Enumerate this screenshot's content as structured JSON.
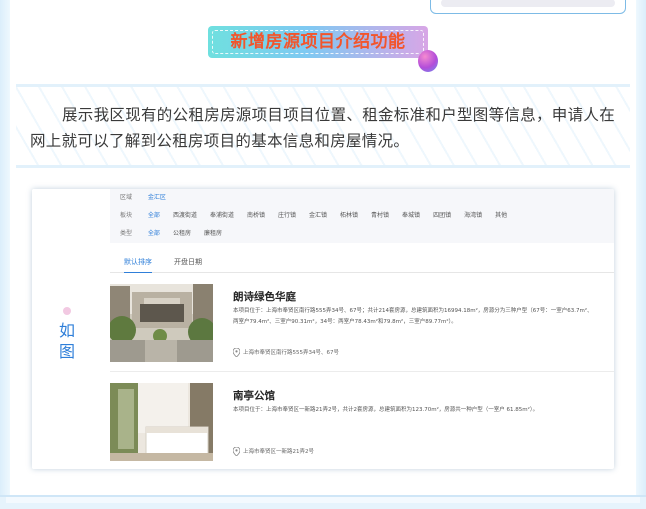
{
  "banner": {
    "title": "新增房源项目介绍功能"
  },
  "description": "展示我区现有的公租房房源项目项目位置、租金标准和户型图等信息，申请人在网上就可以了解到公租房项目的基本信息和房屋情况。",
  "example": {
    "side_label": "如\n图",
    "filters": [
      {
        "label": "区域",
        "options": [
          "金汇区"
        ],
        "selected": 0
      },
      {
        "label": "板块",
        "options": [
          "全部",
          "西渡街道",
          "奉浦街道",
          "南桥镇",
          "庄行镇",
          "金汇镇",
          "柘林镇",
          "青村镇",
          "奉城镇",
          "四团镇",
          "海湾镇",
          "其他"
        ],
        "selected": 0
      },
      {
        "label": "类型",
        "options": [
          "全部",
          "公租房",
          "廉租房"
        ],
        "selected": 0
      }
    ],
    "tabs": [
      {
        "label": "默认排序",
        "active": true
      },
      {
        "label": "开盘日期",
        "active": false
      }
    ],
    "listings": [
      {
        "title": "朗诗绿色华庭",
        "desc": "本项目位于：上海市奉贤区南行路555弄34号、67号；共计214套房源，总建筑面积为16994.18m²，房源分为三种户型（67号：一室户63.7m²、两室户79.4m²、三室户90.31m²，34号：两室户78.43m²和79.8m²，三室户89.77m²）。",
        "address": "上海市奉贤区南行路555弄34号、67号"
      },
      {
        "title": "南亭公馆",
        "desc": "本项目位于：上海市奉贤区一新路21弄2号，共计2套房源，总建筑面积为123.70m²，房源共一种户型（一室户 61.85m²）。",
        "address": "上海市奉贤区一新路21弄2号"
      }
    ]
  },
  "colors": {
    "accent": "#2f7fd9",
    "banner_text": "#f2552c"
  }
}
